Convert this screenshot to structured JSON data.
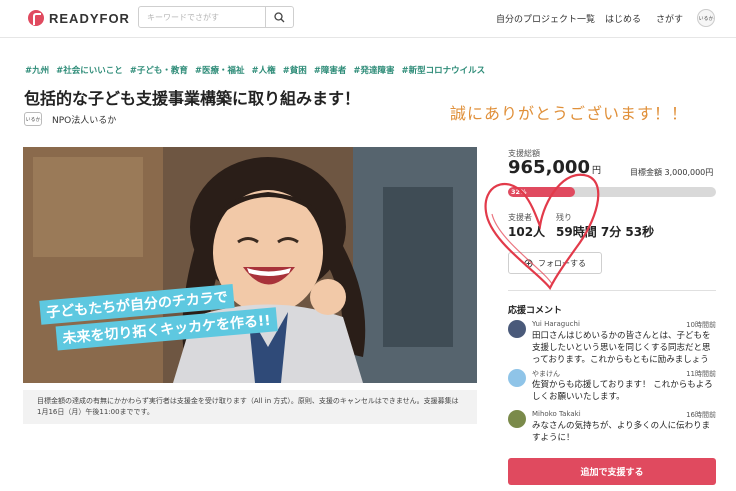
{
  "header": {
    "logo_text": "READYFOR",
    "search_placeholder": "キーワードでさがす",
    "nav": [
      "自分のプロジェクト一覧",
      "はじめる",
      "さがす"
    ],
    "avatar_text": "いるか"
  },
  "project": {
    "tags": [
      "#九州",
      "#社会にいいこと",
      "#子ども・教育",
      "#医療・福祉",
      "#人権",
      "#貧困",
      "#障害者",
      "#発達障害",
      "#新型コロナウイルス"
    ],
    "title": "包括的な子ども支援事業構築に取り組みます！",
    "org_logo_text": "いるか",
    "org_name": "NPO法人いるか",
    "hero_text_line1": "子どもたちが自分のチカラで",
    "hero_text_line2": "未来を切り拓くキッカケを作る!!",
    "caption": "目標金額の達成の有無にかかわらず実行者は支援金を受け取ります（All in 方式）。原則、支援のキャンセルはできません。支援募集は1月16日（月）午後11:00までです。"
  },
  "annotation": {
    "thanks_text": "誠にありがとうございます！！"
  },
  "funding": {
    "label": "支援総額",
    "amount": "965,000",
    "unit": "円",
    "goal": "目標金額 3,000,000円",
    "progress_percent": 32,
    "progress_label": "32%",
    "supporters_label": "支援者",
    "supporters_value": "102人",
    "remaining_label": "残り",
    "remaining_value": "59時間 7分 53秒",
    "follow_label": "フォローする"
  },
  "comments": {
    "title": "応援コメント",
    "items": [
      {
        "name": "Yui Haraguchi",
        "time": "10時間前",
        "text": "田口さんはじめいるかの皆さんとは、子どもを支援したいという思いを同じくする同志だと思っております。これからもともに励みましょう",
        "avatar_color": "#4a5a7a"
      },
      {
        "name": "やまけん",
        "time": "11時間前",
        "text": "佐賀からも応援しております！ これからもよろしくお願いいたします。",
        "avatar_color": "#8fc4e8"
      },
      {
        "name": "Mihoko Takaki",
        "time": "16時間前",
        "text": "みなさんの気持ちが、より多くの人に伝わりますように！",
        "avatar_color": "#7a8a4a"
      }
    ]
  },
  "cta": {
    "support_label": "追加で支援する"
  },
  "colors": {
    "accent": "#e04a5f",
    "tag": "#2e8c78",
    "thanks": "#e0903a"
  }
}
